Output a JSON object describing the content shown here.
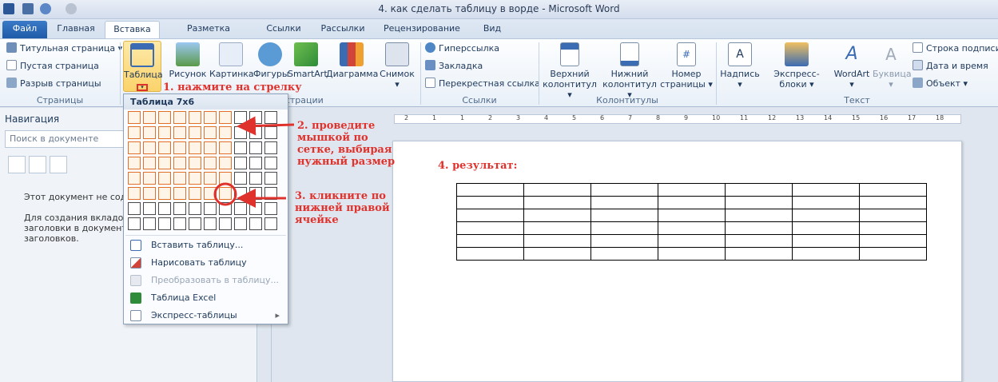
{
  "window": {
    "title": "4. как сделать таблицу в ворде - Microsoft Word"
  },
  "tabs": [
    {
      "label": "Файл"
    },
    {
      "label": "Главная"
    },
    {
      "label": "Вставка"
    },
    {
      "label": "Разметка страницы"
    },
    {
      "label": "Ссылки"
    },
    {
      "label": "Рассылки"
    },
    {
      "label": "Рецензирование"
    },
    {
      "label": "Вид"
    }
  ],
  "ribbon": {
    "pages": {
      "label": "Страницы",
      "items": [
        "Титульная страница",
        "Пустая страница",
        "Разрыв страницы"
      ]
    },
    "illustrations": {
      "label": "Иллюстрации",
      "table_label": "Таблица",
      "picture_label": "Рисунок",
      "clipart_label": "Картинка",
      "shapes_label": "Фигуры",
      "smartart_label": "SmartArt",
      "chart_label": "Диаграмма",
      "screenshot_label": "Снимок"
    },
    "links": {
      "label": "Ссылки",
      "items": [
        "Гиперссылка",
        "Закладка",
        "Перекрестная ссылка"
      ]
    },
    "header_footer": {
      "label": "Колонтитулы",
      "header_l1": "Верхний",
      "header_l2": "колонтитул",
      "footer_l1": "Нижний",
      "footer_l2": "колонтитул",
      "pagenum_l1": "Номер",
      "pagenum_l2": "страницы"
    },
    "text": {
      "label": "Текст",
      "textbox_label": "Надпись",
      "quickparts_label": "Экспресс-блоки",
      "wordart_label": "WordArt",
      "dropcap_label": "Буквица",
      "items": [
        "Строка подписи",
        "Дата и время",
        "Объект"
      ]
    }
  },
  "nav": {
    "title": "Навигация",
    "search_placeholder": "Поиск в документе",
    "msg1": "Этот документ не содер",
    "msg2_l1": "Для создания вкладок к",
    "msg2_l2": "заголовки в документе",
    "msg2_l3": "заголовков."
  },
  "dropdown": {
    "header": "Таблица 7x6",
    "grid_cols": 10,
    "grid_rows": 8,
    "sel_cols": 7,
    "sel_rows": 6,
    "items": [
      {
        "label": "Вставить таблицу...",
        "disabled": false
      },
      {
        "label": "Нарисовать таблицу",
        "disabled": false
      },
      {
        "label": "Преобразовать в таблицу...",
        "disabled": true
      },
      {
        "label": "Таблица Excel",
        "disabled": false
      },
      {
        "label": "Экспресс-таблицы",
        "disabled": false
      }
    ]
  },
  "annotations": {
    "step1": "1. нажмите на стрелку",
    "step2_l1": "2. проведите",
    "step2_l2": "мышкой по",
    "step2_l3": "сетке, выбирая",
    "step2_l4": "нужный размер",
    "step3_l1": "3. кликните по",
    "step3_l2": "нижней правой",
    "step3_l3": "ячейке",
    "step4": "4. результат:"
  },
  "document_table": {
    "rows": 6,
    "cols": 7
  },
  "ruler_labels": [
    "2",
    "1",
    "1",
    "2",
    "3",
    "4",
    "5",
    "6",
    "7",
    "8",
    "9",
    "10",
    "11",
    "12",
    "13",
    "14",
    "15",
    "16",
    "17",
    "18"
  ],
  "colors": {
    "accent": "#1e5aa8",
    "annotation": "#e0322c",
    "grid_highlight": "#e0702a"
  }
}
